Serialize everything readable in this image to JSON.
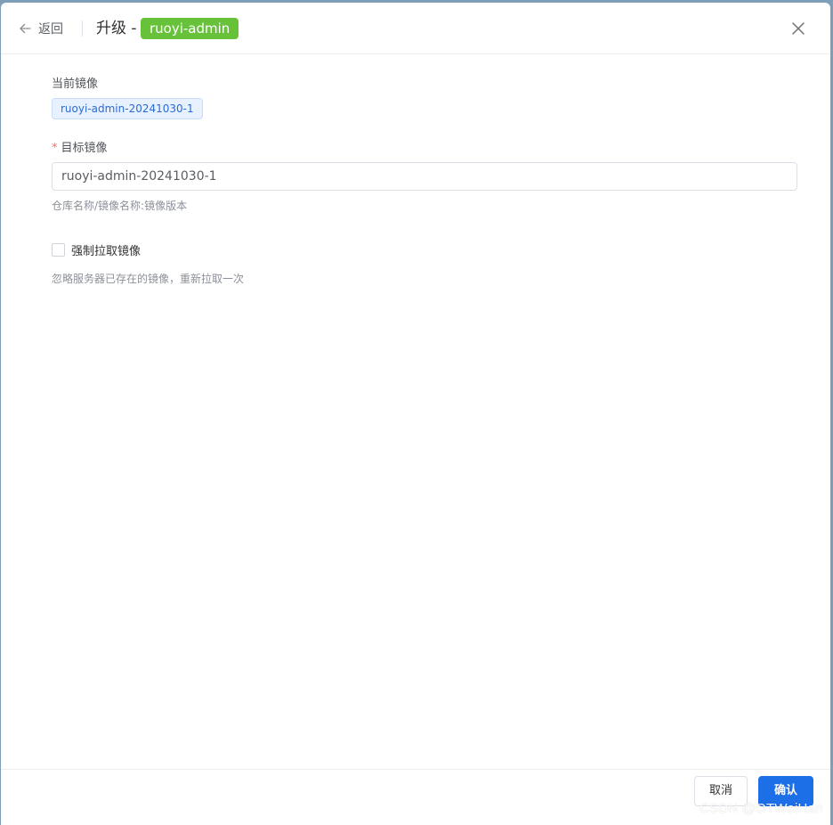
{
  "header": {
    "back_label": "返回",
    "title": "升级 -",
    "app_name": "ruoyi-admin",
    "app_tag_color": "#67c23a"
  },
  "form": {
    "current_image_label": "当前镜像",
    "current_image_value": "ruoyi-admin-20241030-1",
    "target_image_label": "目标镜像",
    "target_image_required_mark": "*",
    "target_image_value": "ruoyi-admin-20241030-1",
    "target_image_hint": "仓库名称/镜像名称:镜像版本",
    "force_pull_label": "强制拉取镜像",
    "force_pull_checked": false,
    "force_pull_hint": "忽略服务器已存在的镜像，重新拉取一次"
  },
  "footer": {
    "cancel_label": "取消",
    "confirm_label": "确认",
    "primary_color": "#1d6fe8"
  },
  "watermark": "CSDN @OTWeiHan",
  "icons": {
    "back": "arrow-left-icon",
    "close": "close-icon"
  }
}
